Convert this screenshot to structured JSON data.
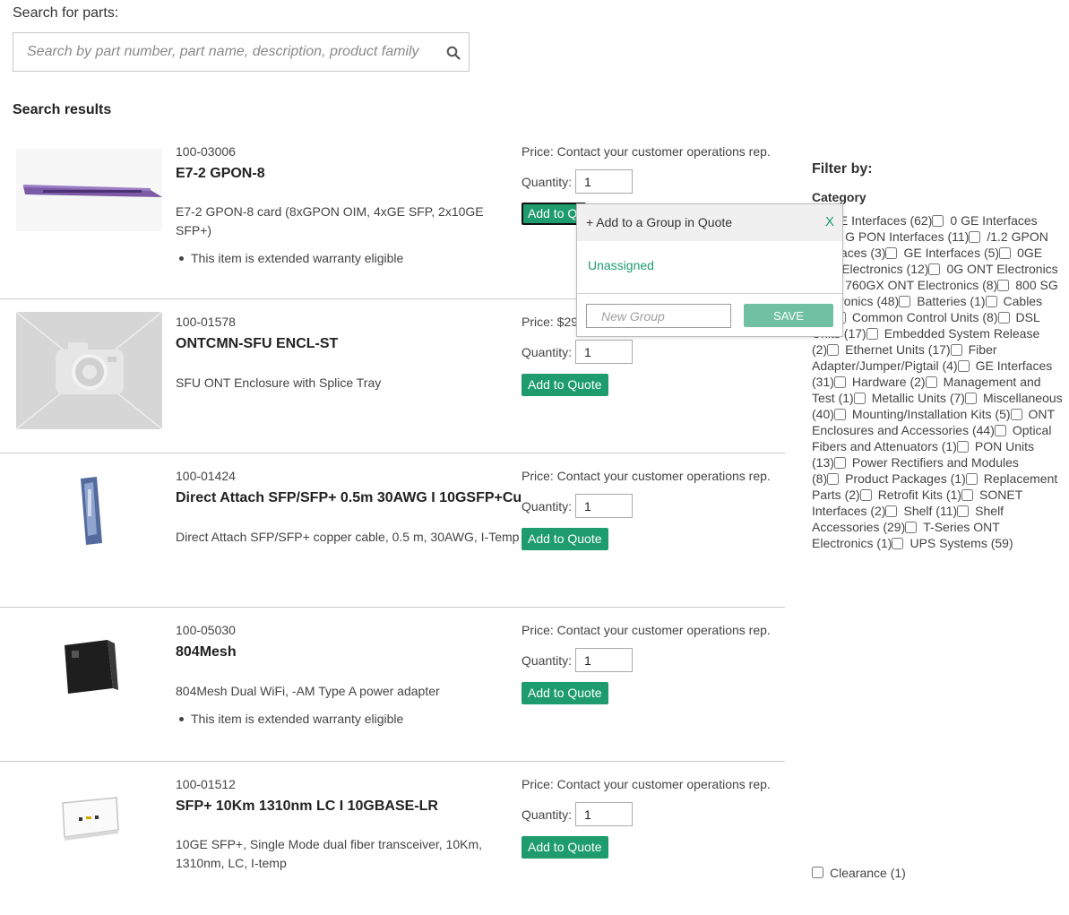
{
  "search": {
    "label": "Search for parts:",
    "placeholder": "Search by part number, part name, description, product family",
    "value": ""
  },
  "results_title": "Search results",
  "products": [
    {
      "part_number": "100-03006",
      "name": "E7-2 GPON-8",
      "description": "E7-2 GPON-8 card (8xGPON OIM, 4xGE SFP, 2x10GE SFP+)",
      "note": "This item is extended warranty eligible",
      "price": "Price: Contact your customer operations rep.",
      "quantity_label": "Quantity:",
      "quantity": "1",
      "add_label": "Add to Quote"
    },
    {
      "part_number": "100-01578",
      "name": "ONTCMN-SFU ENCL-ST",
      "description": "SFU ONT Enclosure with Splice Tray",
      "note": "",
      "price": "Price: $29",
      "quantity_label": "Quantity:",
      "quantity": "1",
      "add_label": "Add to Quote"
    },
    {
      "part_number": "100-01424",
      "name": "Direct Attach SFP/SFP+ 0.5m 30AWG I 10GSFP+Cu",
      "description": "Direct Attach SFP/SFP+ copper cable, 0.5 m, 30AWG, I-Temp",
      "note": "",
      "price": "Price: Contact your customer operations rep.",
      "quantity_label": "Quantity:",
      "quantity": "1",
      "add_label": "Add to Quote"
    },
    {
      "part_number": "100-05030",
      "name": "804Mesh",
      "description": "804Mesh Dual WiFi, -AM Type A power adapter",
      "note": "This item is extended warranty eligible",
      "price": "Price: Contact your customer operations rep.",
      "quantity_label": "Quantity:",
      "quantity": "1",
      "add_label": "Add to Quote"
    },
    {
      "part_number": "100-01512",
      "name": "SFP+ 10Km 1310nm LC I 10GBASE-LR",
      "description": "10GE SFP+, Single Mode dual fiber transceiver, 10Km, 1310nm, LC, I-temp",
      "note": "",
      "price": "Price: Contact your customer operations rep.",
      "quantity_label": "Quantity:",
      "quantity": "1",
      "add_label": "Add to Quote"
    }
  ],
  "popup": {
    "title": "+ Add to a Group in Quote",
    "close": "X",
    "item": "Unassigned",
    "group_placeholder": "New Group",
    "save_label": "SAVE"
  },
  "filter": {
    "title": "Filter by:",
    "category_label": "Category",
    "categories": [
      "GE Interfaces (62)",
      "0 GE Interfaces (4)",
      "G PON Interfaces (11)",
      "/1.2 GPON Interfaces (3)",
      "GE Interfaces (5)",
      "0GE ONT Electronics (12)",
      "0G ONT Electronics (1)",
      "760GX ONT Electronics (8)",
      "800 SG Electronics (48)",
      "Batteries (1)",
      "Cables (50)",
      "Common Control Units (8)",
      "DSL Units (17)",
      "Embedded System Release (2)",
      "Ethernet Units (17)",
      "Fiber Adapter/Jumper/Pigtail (4)",
      "GE Interfaces (31)",
      "Hardware (2)",
      "Management and Test (1)",
      "Metallic Units (7)",
      "Miscellaneous (40)",
      "Mounting/Installation Kits (5)",
      "ONT Enclosures and Accessories (44)",
      "Optical Fibers and Attenuators (1)",
      "PON Units (13)",
      "Power Rectifiers and Modules (8)",
      "Product Packages (1)",
      "Replacement Parts (2)",
      "Retrofit Kits (1)",
      "SONET Interfaces (2)",
      "Shelf (11)",
      "Shelf Accessories (29)",
      "T-Series ONT Electronics (1)",
      "UPS Systems (59)"
    ],
    "clearance": "Clearance (1)"
  },
  "colors": {
    "accent": "#1e9c6e",
    "save_disabled": "#6fc1a2",
    "separator": "#c9c9c9"
  },
  "icons": [
    "search-icon",
    "product-image",
    "placeholder-camera-image"
  ]
}
